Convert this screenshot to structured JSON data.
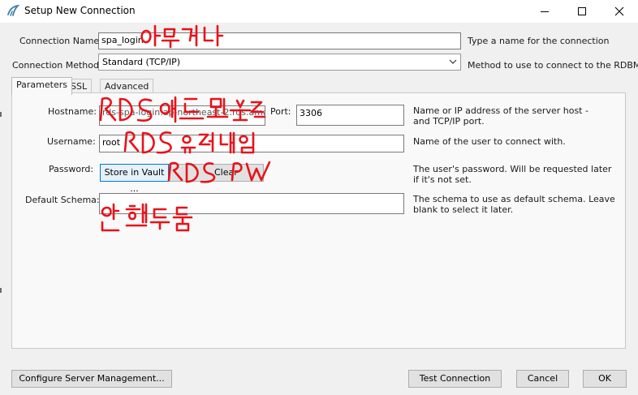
{
  "window": {
    "title": "Setup New Connection",
    "controls": {
      "minimize": "minimize-icon",
      "maximize": "maximize-icon",
      "close": "close-icon"
    }
  },
  "connection": {
    "name_label": "Connection Name:",
    "name_value": "spa_login",
    "name_hint": "Type a name for the connection",
    "method_label": "Connection Method:",
    "method_value": "Standard (TCP/IP)",
    "method_hint": "Method to use to connect to the RDBMS"
  },
  "tabs": [
    {
      "label": "Parameters",
      "active": true
    },
    {
      "label": "SSL",
      "active": false
    },
    {
      "label": "Advanced",
      "active": false
    }
  ],
  "parameters": {
    "hostname_label": "Hostname:",
    "hostname_value": "rds-spa-login.ap-northeast-2.rds.amazonaws.com",
    "port_label": "Port:",
    "port_value": "3306",
    "hostname_hint": "Name or IP address of the server host - and TCP/IP port.",
    "username_label": "Username:",
    "username_value": "root",
    "username_hint": "Name of the user to connect with.",
    "password_label": "Password:",
    "store_button": "Store in Vault ...",
    "clear_button": "Clear",
    "password_hint": "The user's password. Will be requested later if it's not set.",
    "schema_label": "Default Schema:",
    "schema_value": "",
    "schema_hint": "The schema to use as default schema. Leave blank to select it later."
  },
  "footer": {
    "configure_button": "Configure Server Management...",
    "test_button": "Test Connection",
    "cancel_button": "Cancel",
    "ok_button": "OK"
  },
  "annotations": {
    "name_note": "아무거나",
    "hostname_note": "RDS 엔드포인트",
    "username_note": "RDS 유저네임",
    "password_note": "RDS PW",
    "schema_note": "안해도됨",
    "color": "#e8121a"
  }
}
